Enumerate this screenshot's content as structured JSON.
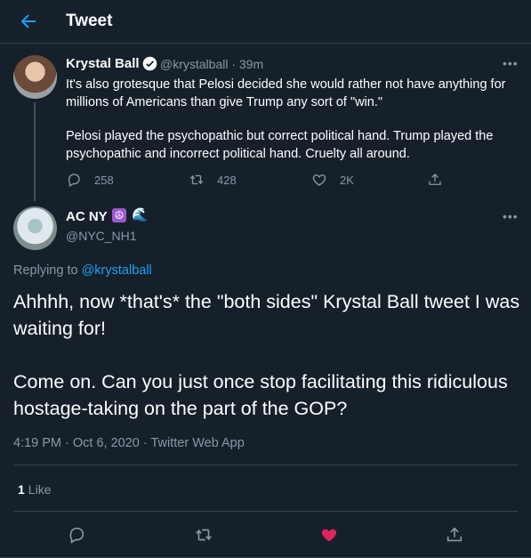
{
  "header": {
    "title": "Tweet"
  },
  "parent_tweet": {
    "name": "Krystal Ball",
    "handle_time": "@krystalball · 39m",
    "paragraphs": [
      "It's also grotesque that Pelosi decided she would rather not have anything for millions of Americans than give Trump any sort of \"win.\"",
      "Pelosi played the psychopathic but correct political hand. Trump played the psychopathic and incorrect political hand. Cruelty all around."
    ],
    "reply_count": "258",
    "retweet_count": "428",
    "like_count": "2K"
  },
  "main_tweet": {
    "name": "AC NY",
    "peace_emoji": "☮",
    "wave_emoji": "🌊",
    "handle": "@NYC_NH1",
    "replying_prefix": "Replying to ",
    "replying_handle": "@krystalball",
    "paragraphs": [
      "Ahhhh, now *that's* the \"both sides\" Krystal Ball tweet I was waiting for!",
      "Come on. Can you just once stop facilitating this ridiculous hostage-taking on the part of the GOP?"
    ],
    "timestamp": "4:19 PM · Oct 6, 2020 · Twitter Web App",
    "like_count": "1",
    "like_label": "Like"
  },
  "colors": {
    "background": "#15202b",
    "accent": "#1da1f2",
    "muted": "#8899a6",
    "like": "#e0245e",
    "divider": "#38444d"
  }
}
